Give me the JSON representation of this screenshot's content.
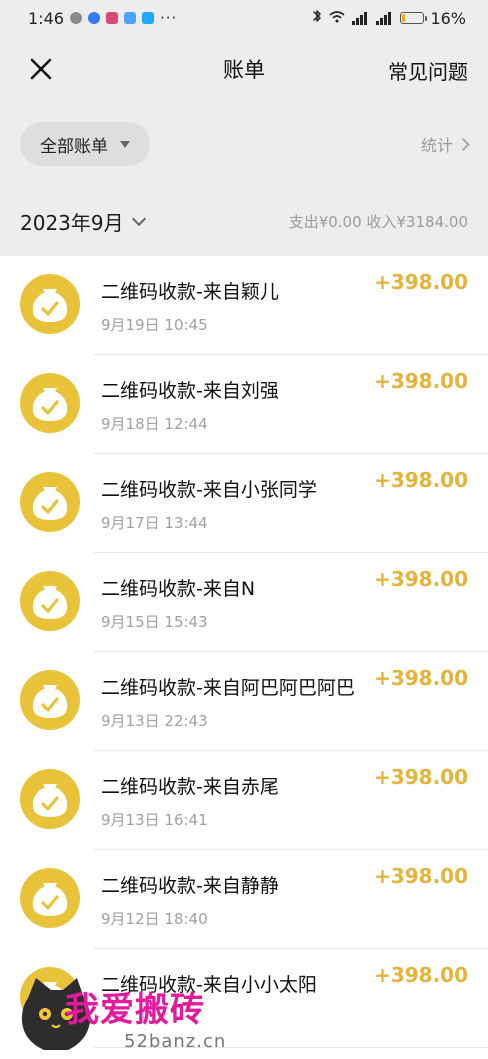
{
  "status_bar": {
    "time": "1:46",
    "dots": "···",
    "battery_text": "16%",
    "battery_level": 0.16
  },
  "header": {
    "title": "账单",
    "faq_label": "常见问题"
  },
  "filter": {
    "all_bills_label": "全部账单",
    "stats_label": "统计"
  },
  "month": {
    "label": "2023年9月",
    "summary": "支出¥0.00 收入¥3184.00"
  },
  "transactions": [
    {
      "title": "二维码收款-来自颖儿",
      "time": "9月19日 10:45",
      "amount": "+398.00"
    },
    {
      "title": "二维码收款-来自刘强",
      "time": "9月18日 12:44",
      "amount": "+398.00"
    },
    {
      "title": "二维码收款-来自小张同学",
      "time": "9月17日 13:44",
      "amount": "+398.00"
    },
    {
      "title": "二维码收款-来自N",
      "time": "9月15日 15:43",
      "amount": "+398.00"
    },
    {
      "title": "二维码收款-来自阿巴阿巴阿巴",
      "time": "9月13日 22:43",
      "amount": "+398.00"
    },
    {
      "title": "二维码收款-来自赤尾",
      "time": "9月13日 16:41",
      "amount": "+398.00"
    },
    {
      "title": "二维码收款-来自静静",
      "time": "9月12日 18:40",
      "amount": "+398.00"
    },
    {
      "title": "二维码收款-来自小小太阳",
      "time": "",
      "amount": "+398.00"
    }
  ],
  "watermark": {
    "title": "我爱搬砖",
    "domain": "52banz.cn"
  },
  "colors": {
    "background": "#ededed",
    "icon_yellow": "#e8c33a",
    "amount": "#e3b439",
    "secondary_text": "#9b9b9b",
    "watermark_pink": "#e4199d"
  }
}
